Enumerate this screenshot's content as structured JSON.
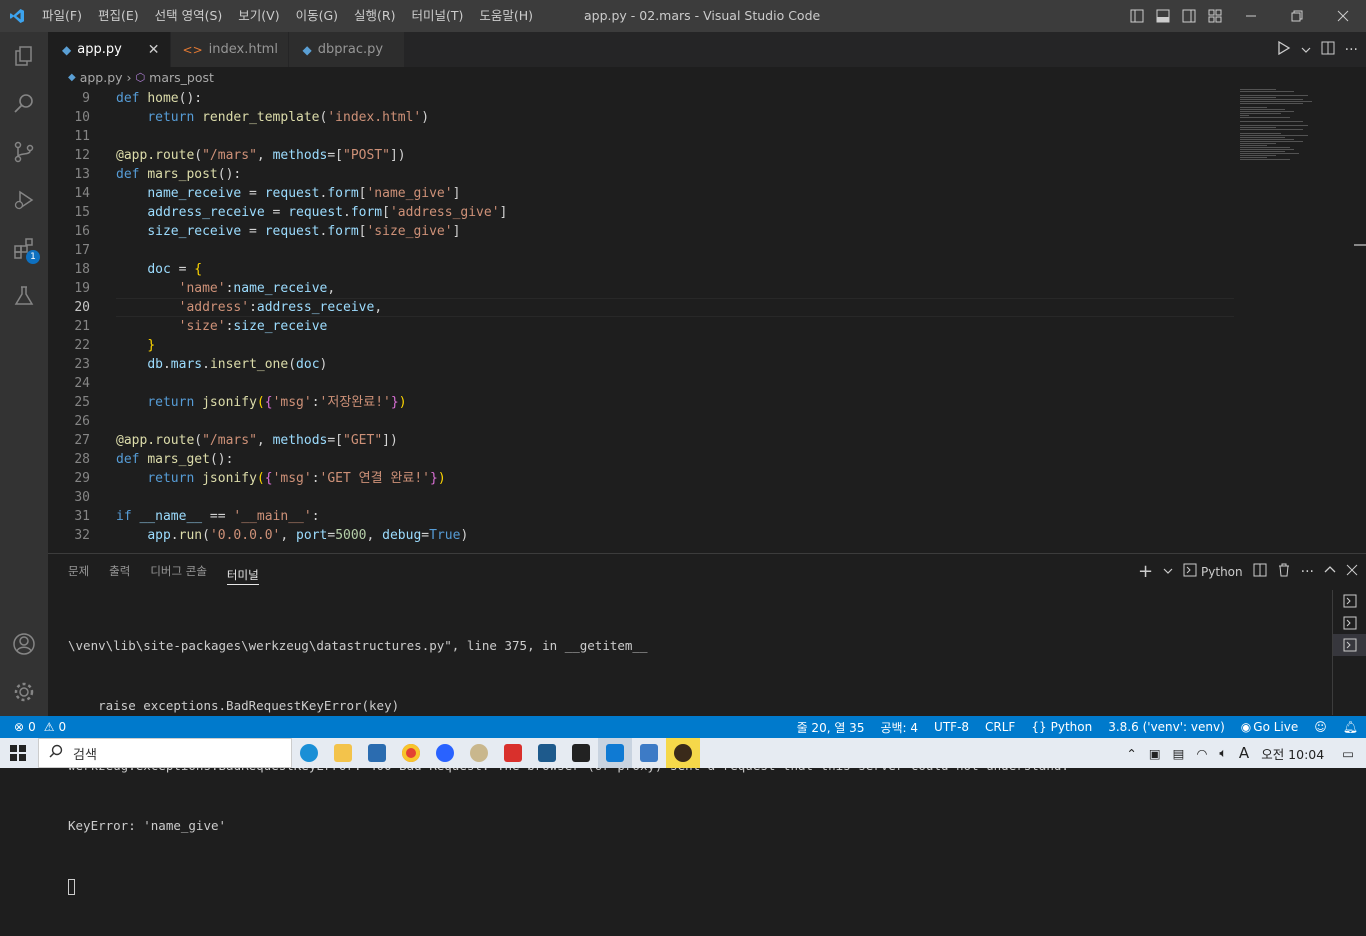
{
  "window": {
    "title": "app.py - 02.mars - Visual Studio Code"
  },
  "menu": [
    "파일(F)",
    "편집(E)",
    "선택 영역(S)",
    "보기(V)",
    "이동(G)",
    "실행(R)",
    "터미널(T)",
    "도움말(H)"
  ],
  "tabs": [
    {
      "label": "app.py",
      "icon": "python-icon",
      "active": true
    },
    {
      "label": "index.html",
      "icon": "html-icon",
      "active": false
    },
    {
      "label": "dbprac.py",
      "icon": "python-icon",
      "active": false
    }
  ],
  "breadcrumb": {
    "file": "app.py",
    "symbol": "mars_post"
  },
  "activity": {
    "extensions_badge": "1"
  },
  "editor": {
    "current_line": "20",
    "lines": [
      {
        "n": "9",
        "tokens": [
          [
            "kw",
            "def "
          ],
          [
            "fn",
            "home"
          ],
          [
            "pl",
            "():"
          ]
        ]
      },
      {
        "n": "10",
        "tokens": [
          [
            "pl",
            "    "
          ],
          [
            "kw",
            "return "
          ],
          [
            "fn",
            "render_template"
          ],
          [
            "pl",
            "("
          ],
          [
            "st",
            "'index.html'"
          ],
          [
            "pl",
            ")"
          ]
        ]
      },
      {
        "n": "11",
        "tokens": []
      },
      {
        "n": "12",
        "tokens": [
          [
            "dc",
            "@app.route"
          ],
          [
            "pl",
            "("
          ],
          [
            "st",
            "\"/mars\""
          ],
          [
            "pl",
            ", "
          ],
          [
            "vr",
            "methods"
          ],
          [
            "pl",
            "=["
          ],
          [
            "st",
            "\"POST\""
          ],
          [
            "pl",
            "])"
          ]
        ]
      },
      {
        "n": "13",
        "tokens": [
          [
            "kw",
            "def "
          ],
          [
            "fn",
            "mars_post"
          ],
          [
            "pl",
            "():"
          ]
        ]
      },
      {
        "n": "14",
        "tokens": [
          [
            "pl",
            "    "
          ],
          [
            "vr",
            "name_receive"
          ],
          [
            "pl",
            " = "
          ],
          [
            "vr",
            "request"
          ],
          [
            "pl",
            "."
          ],
          [
            "vr",
            "form"
          ],
          [
            "pl",
            "["
          ],
          [
            "st",
            "'name_give'"
          ],
          [
            "pl",
            "]"
          ]
        ]
      },
      {
        "n": "15",
        "tokens": [
          [
            "pl",
            "    "
          ],
          [
            "vr",
            "address_receive"
          ],
          [
            "pl",
            " = "
          ],
          [
            "vr",
            "request"
          ],
          [
            "pl",
            "."
          ],
          [
            "vr",
            "form"
          ],
          [
            "pl",
            "["
          ],
          [
            "st",
            "'address_give'"
          ],
          [
            "pl",
            "]"
          ]
        ]
      },
      {
        "n": "16",
        "tokens": [
          [
            "pl",
            "    "
          ],
          [
            "vr",
            "size_receive"
          ],
          [
            "pl",
            " = "
          ],
          [
            "vr",
            "request"
          ],
          [
            "pl",
            "."
          ],
          [
            "vr",
            "form"
          ],
          [
            "pl",
            "["
          ],
          [
            "st",
            "'size_give'"
          ],
          [
            "pl",
            "]"
          ]
        ]
      },
      {
        "n": "17",
        "tokens": []
      },
      {
        "n": "18",
        "tokens": [
          [
            "pl",
            "    "
          ],
          [
            "vr",
            "doc"
          ],
          [
            "pl",
            " = "
          ],
          [
            "br1",
            "{"
          ]
        ]
      },
      {
        "n": "19",
        "tokens": [
          [
            "pl",
            "        "
          ],
          [
            "st",
            "'name'"
          ],
          [
            "pl",
            ":"
          ],
          [
            "vr",
            "name_receive"
          ],
          [
            "pl",
            ","
          ]
        ]
      },
      {
        "n": "20",
        "tokens": [
          [
            "pl",
            "        "
          ],
          [
            "st",
            "'address'"
          ],
          [
            "pl",
            ":"
          ],
          [
            "vr",
            "address_receive"
          ],
          [
            "pl",
            ","
          ]
        ]
      },
      {
        "n": "21",
        "tokens": [
          [
            "pl",
            "        "
          ],
          [
            "st",
            "'size'"
          ],
          [
            "pl",
            ":"
          ],
          [
            "vr",
            "size_receive"
          ]
        ]
      },
      {
        "n": "22",
        "tokens": [
          [
            "pl",
            "    "
          ],
          [
            "br1",
            "}"
          ]
        ]
      },
      {
        "n": "23",
        "tokens": [
          [
            "pl",
            "    "
          ],
          [
            "vr",
            "db"
          ],
          [
            "pl",
            "."
          ],
          [
            "vr",
            "mars"
          ],
          [
            "pl",
            "."
          ],
          [
            "fn",
            "insert_one"
          ],
          [
            "pl",
            "("
          ],
          [
            "vr",
            "doc"
          ],
          [
            "pl",
            ")"
          ]
        ]
      },
      {
        "n": "24",
        "tokens": []
      },
      {
        "n": "25",
        "tokens": [
          [
            "pl",
            "    "
          ],
          [
            "kw",
            "return "
          ],
          [
            "fn",
            "jsonify"
          ],
          [
            "br1",
            "("
          ],
          [
            "br2",
            "{"
          ],
          [
            "st",
            "'msg'"
          ],
          [
            "pl",
            ":"
          ],
          [
            "st",
            "'저장완료!'"
          ],
          [
            "br2",
            "}"
          ],
          [
            "br1",
            ")"
          ]
        ]
      },
      {
        "n": "26",
        "tokens": []
      },
      {
        "n": "27",
        "tokens": [
          [
            "dc",
            "@app.route"
          ],
          [
            "pl",
            "("
          ],
          [
            "st",
            "\"/mars\""
          ],
          [
            "pl",
            ", "
          ],
          [
            "vr",
            "methods"
          ],
          [
            "pl",
            "=["
          ],
          [
            "st",
            "\"GET\""
          ],
          [
            "pl",
            "])"
          ]
        ]
      },
      {
        "n": "28",
        "tokens": [
          [
            "kw",
            "def "
          ],
          [
            "fn",
            "mars_get"
          ],
          [
            "pl",
            "():"
          ]
        ]
      },
      {
        "n": "29",
        "tokens": [
          [
            "pl",
            "    "
          ],
          [
            "kw",
            "return "
          ],
          [
            "fn",
            "jsonify"
          ],
          [
            "br1",
            "("
          ],
          [
            "br2",
            "{"
          ],
          [
            "st",
            "'msg'"
          ],
          [
            "pl",
            ":"
          ],
          [
            "st",
            "'GET 연결 완료!'"
          ],
          [
            "br2",
            "}"
          ],
          [
            "br1",
            ")"
          ]
        ]
      },
      {
        "n": "30",
        "tokens": []
      },
      {
        "n": "31",
        "tokens": [
          [
            "kw",
            "if "
          ],
          [
            "vr",
            "__name__"
          ],
          [
            "pl",
            " == "
          ],
          [
            "st",
            "'__main__'"
          ],
          [
            "pl",
            ":"
          ]
        ]
      },
      {
        "n": "32",
        "tokens": [
          [
            "pl",
            "    "
          ],
          [
            "vr",
            "app"
          ],
          [
            "pl",
            "."
          ],
          [
            "fn",
            "run"
          ],
          [
            "pl",
            "("
          ],
          [
            "st",
            "'0.0.0.0'"
          ],
          [
            "pl",
            ", "
          ],
          [
            "vr",
            "port"
          ],
          [
            "pl",
            "="
          ],
          [
            "nm",
            "5000"
          ],
          [
            "pl",
            ", "
          ],
          [
            "vr",
            "debug"
          ],
          [
            "pl",
            "="
          ],
          [
            "kw",
            "True"
          ],
          [
            "pl",
            ")"
          ]
        ]
      }
    ]
  },
  "panel": {
    "tabs": [
      "문제",
      "출력",
      "디버그 콘솔",
      "터미널"
    ],
    "active_tab": "터미널",
    "shell": "Python",
    "terminal_lines": [
      "\\venv\\lib\\site-packages\\werkzeug\\datastructures.py\", line 375, in __getitem__",
      "    raise exceptions.BadRequestKeyError(key)",
      "werkzeug.exceptions.BadRequestKeyError: 400 Bad Request: The browser (or proxy) sent a request that this server could not understand.",
      "KeyError: 'name_give'"
    ]
  },
  "status": {
    "errors": "0",
    "warnings": "0",
    "position": "줄 20, 열 35",
    "spaces": "공백: 4",
    "encoding": "UTF-8",
    "eol": "CRLF",
    "language": "Python",
    "interpreter": "3.8.6 ('venv': venv)",
    "golive": "Go Live"
  },
  "taskbar": {
    "search_placeholder": "검색",
    "ime": "A",
    "clock": "오전 10:04"
  },
  "colors": {
    "statusbar": "#007acc",
    "activity": "#333333",
    "editor": "#1e1e1e",
    "titlebar": "#3c3c3c"
  }
}
